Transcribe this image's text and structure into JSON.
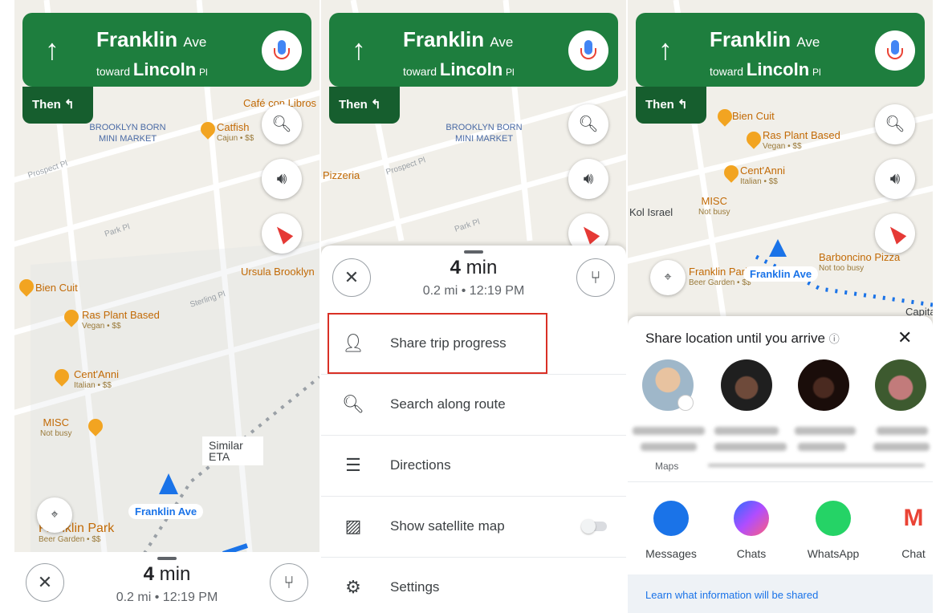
{
  "nav": {
    "street_main": "Franklin",
    "street_main_suffix": "Ave",
    "toward_label": "toward",
    "toward_street": "Lincoln",
    "toward_suffix": "Pl",
    "then_label": "Then"
  },
  "eta": {
    "minutes": "4",
    "unit": "min",
    "distance": "0.2 mi",
    "separator": "•",
    "arrival": "12:19 PM"
  },
  "map": {
    "poi_left": [
      {
        "name": "Café con Libros",
        "sub": ""
      },
      {
        "name": "Catfish",
        "sub": "Cajun • $$"
      },
      {
        "name": "BROOKLYN BORN MINI MARKET",
        "sub": ""
      },
      {
        "name": "Ursula Brooklyn",
        "sub": ""
      },
      {
        "name": "Bien Cuit",
        "sub": ""
      },
      {
        "name": "Ras Plant Based",
        "sub": "Vegan • $$"
      },
      {
        "name": "Cent'Anni",
        "sub": "Italian • $$"
      },
      {
        "name": "MISC",
        "sub": "Not busy"
      },
      {
        "name": "Franklin Park",
        "sub": "Beer Garden • $$"
      }
    ],
    "streets": [
      "Prospect Pl",
      "Park Pl",
      "Sterling Pl"
    ],
    "similar_eta": "Similar ETA",
    "location_label": "Franklin Ave",
    "pizzeria": "Pizzeria",
    "kol_israel": "Kol Israel",
    "barboncino": "Barboncino Pizza",
    "barboncino_sub": "Not too busy",
    "capital": "Capita"
  },
  "menu": {
    "items": [
      {
        "label": "Share trip progress",
        "icon": "share-person-icon"
      },
      {
        "label": "Search along route",
        "icon": "search-icon"
      },
      {
        "label": "Directions",
        "icon": "list-icon"
      },
      {
        "label": "Show satellite map",
        "icon": "satellite-icon"
      },
      {
        "label": "Settings",
        "icon": "gear-icon"
      }
    ],
    "highlight_color": "#d93025"
  },
  "share": {
    "title": "Share location until you arrive",
    "maps_label": "Maps",
    "apps": [
      {
        "name": "Messages",
        "color": "#1a73e8"
      },
      {
        "name": "Chats",
        "color": "#8a4dff"
      },
      {
        "name": "WhatsApp",
        "color": "#25d366"
      },
      {
        "name": "Chat",
        "color": "#ea4335"
      }
    ],
    "learn_link": "Learn what information will be shared"
  },
  "colors": {
    "nav_green": "#1e7e3e",
    "nav_green_dark": "#165e2e",
    "poi_orange": "#f2a421",
    "route_blue": "#1a73e8"
  }
}
